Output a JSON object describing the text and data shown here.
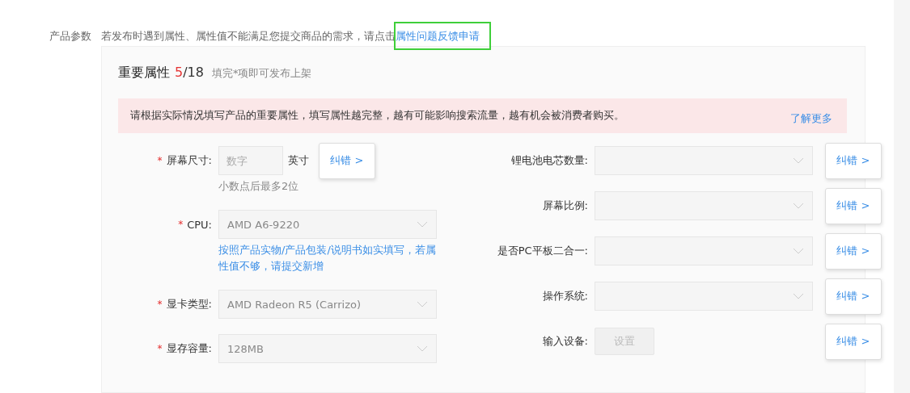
{
  "section": {
    "label": "产品参数",
    "notice": "若发布时遇到属性、属性值不能满足您提交商品的需求，请点击",
    "notice_link": "属性问题反馈申请"
  },
  "panel": {
    "title": "重要属性",
    "count": "5",
    "total": "/18",
    "subtitle": "填完*项即可发布上架",
    "alert": {
      "text": "请根据实际情况填写产品的重要属性，填写属性越完整，越有可能影响搜索流量，越有机会被消费者购买。",
      "link": "了解更多"
    },
    "left_fields": [
      {
        "kind": "number",
        "required_mark": "*",
        "label": "屏幕尺寸:",
        "placeholder": "数字",
        "unit": "英寸",
        "correction": "纠错 >",
        "hint": {
          "kind": "note",
          "text": "小数点后最多2位"
        }
      },
      {
        "kind": "select",
        "required_mark": "*",
        "label": "CPU:",
        "value": "AMD A6-9220",
        "hint": {
          "kind": "link",
          "text": "按照产品实物/产品包装/说明书如实填写，若属性值不够，请提交新增"
        }
      },
      {
        "kind": "select",
        "required_mark": "*",
        "label": "显卡类型:",
        "value": "AMD Radeon R5 (Carrizo)"
      },
      {
        "kind": "select",
        "required_mark": "*",
        "label": "显存容量:",
        "value": "128MB"
      }
    ],
    "right_fields": [
      {
        "kind": "select",
        "label": "锂电池电芯数量:",
        "correction": "纠错 >"
      },
      {
        "kind": "select",
        "label": "屏幕比例:",
        "correction": "纠错 >"
      },
      {
        "kind": "select",
        "label": "是否PC平板二合一:",
        "correction": "纠错 >"
      },
      {
        "kind": "select",
        "label": "操作系统:",
        "correction": "纠错 >"
      },
      {
        "kind": "button",
        "label": "输入设备:",
        "button": "设置",
        "correction": "纠错 >"
      }
    ]
  }
}
